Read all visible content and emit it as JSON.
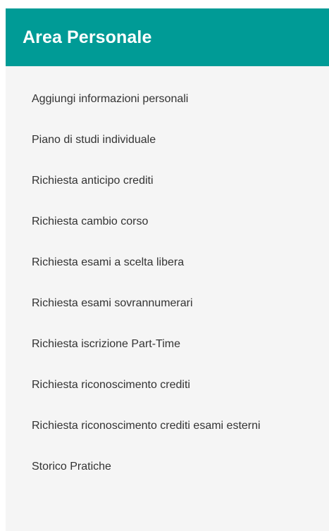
{
  "panel": {
    "title": "Area Personale",
    "header_color": "#009b96",
    "items": [
      {
        "label": "Aggiungi informazioni personali"
      },
      {
        "label": "Piano di studi individuale"
      },
      {
        "label": "Richiesta anticipo crediti"
      },
      {
        "label": "Richiesta cambio corso"
      },
      {
        "label": "Richiesta esami a scelta libera"
      },
      {
        "label": "Richiesta esami sovrannumerari"
      },
      {
        "label": "Richiesta iscrizione Part-Time"
      },
      {
        "label": "Richiesta riconoscimento crediti"
      },
      {
        "label": "Richiesta riconoscimento crediti esami esterni"
      },
      {
        "label": "Storico Pratiche"
      }
    ]
  }
}
